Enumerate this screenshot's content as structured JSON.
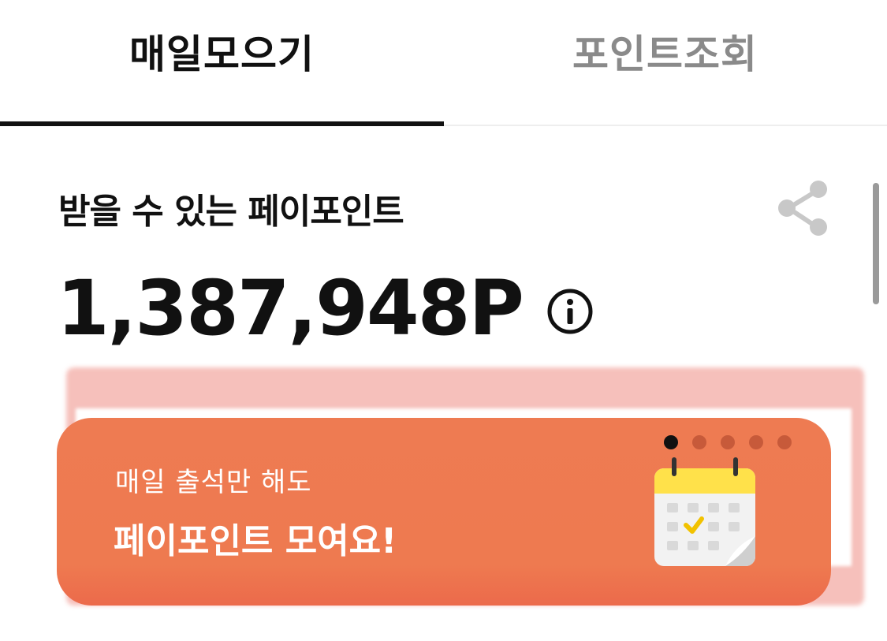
{
  "tabs": {
    "daily_label": "매일모으기",
    "points_label": "포인트조회",
    "active": "daily"
  },
  "points": {
    "title": "받을 수 있는 페이포인트",
    "amount": "1,387,948P"
  },
  "banner": {
    "subtitle": "매일 출석만 해도",
    "headline": "페이포인트 모여요!",
    "page_count": 5,
    "active_page": 1,
    "icon": "calendar-check-icon",
    "background_color": "#EE7B52"
  },
  "colors": {
    "text_primary": "#111111",
    "text_inactive": "#8A8A8A",
    "accent": "#EE7B52"
  }
}
